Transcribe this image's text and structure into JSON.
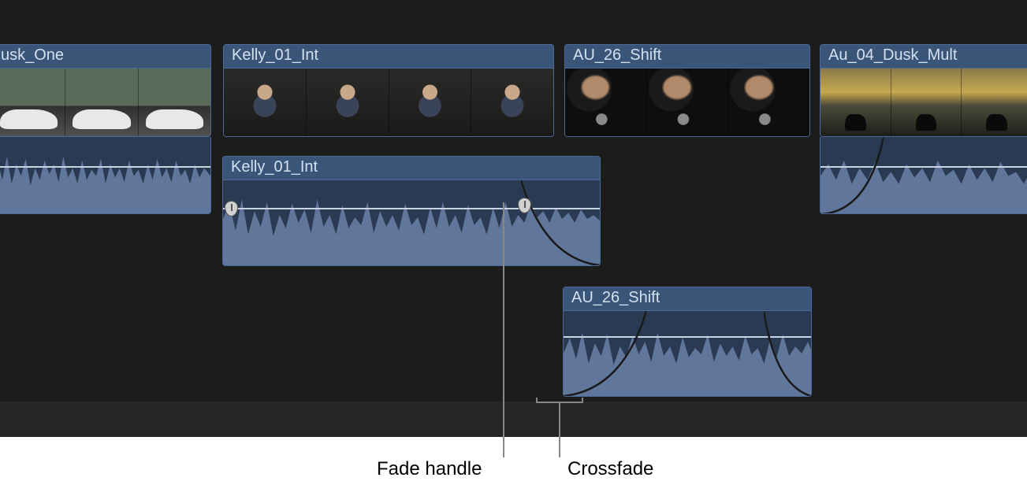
{
  "clips": {
    "video1": {
      "label": "usk_One"
    },
    "video2": {
      "label": "Kelly_01_Int"
    },
    "video3": {
      "label": "AU_26_Shift"
    },
    "video4": {
      "label": "Au_04_Dusk_Mult"
    },
    "audio1": {
      "label": "Kelly_01_Int"
    },
    "audio2": {
      "label": "AU_26_Shift"
    }
  },
  "annotations": {
    "fade_handle": "Fade handle",
    "crossfade": "Crossfade"
  }
}
